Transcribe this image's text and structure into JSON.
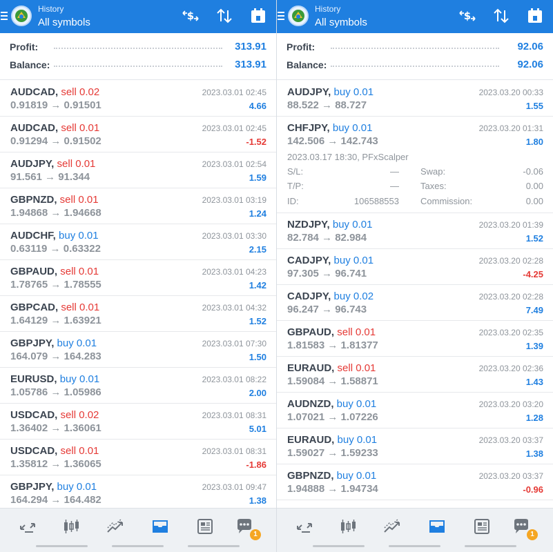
{
  "left": {
    "header": {
      "subtitle": "History",
      "title": "All symbols"
    },
    "summary": {
      "profit_label": "Profit:",
      "profit_value": "313.91",
      "balance_label": "Balance:",
      "balance_value": "313.91"
    },
    "trades": [
      {
        "symbol": "AUDCAD,",
        "side": "sell 0.02",
        "prices": "0.91819 → 0.91501",
        "time": "2023.03.01 02:45",
        "profit": "4.66"
      },
      {
        "symbol": "AUDCAD,",
        "side": "sell 0.01",
        "prices": "0.91294 → 0.91502",
        "time": "2023.03.01 02:45",
        "profit": "-1.52"
      },
      {
        "symbol": "AUDJPY,",
        "side": "sell 0.01",
        "prices": "91.561 → 91.344",
        "time": "2023.03.01 02:54",
        "profit": "1.59"
      },
      {
        "symbol": "GBPNZD,",
        "side": "sell 0.01",
        "prices": "1.94868 → 1.94668",
        "time": "2023.03.01 03:19",
        "profit": "1.24"
      },
      {
        "symbol": "AUDCHF,",
        "side": "buy 0.01",
        "prices": "0.63119 → 0.63322",
        "time": "2023.03.01 03:30",
        "profit": "2.15"
      },
      {
        "symbol": "GBPAUD,",
        "side": "sell 0.01",
        "prices": "1.78765 → 1.78555",
        "time": "2023.03.01 04:23",
        "profit": "1.42"
      },
      {
        "symbol": "GBPCAD,",
        "side": "sell 0.01",
        "prices": "1.64129 → 1.63921",
        "time": "2023.03.01 04:32",
        "profit": "1.52"
      },
      {
        "symbol": "GBPJPY,",
        "side": "buy 0.01",
        "prices": "164.079 → 164.283",
        "time": "2023.03.01 07:30",
        "profit": "1.50"
      },
      {
        "symbol": "EURUSD,",
        "side": "buy 0.01",
        "prices": "1.05786 → 1.05986",
        "time": "2023.03.01 08:22",
        "profit": "2.00"
      },
      {
        "symbol": "USDCAD,",
        "side": "sell 0.02",
        "prices": "1.36402 → 1.36061",
        "time": "2023.03.01 08:31",
        "profit": "5.01"
      },
      {
        "symbol": "USDCAD,",
        "side": "sell 0.01",
        "prices": "1.35812 → 1.36065",
        "time": "2023.03.01 08:31",
        "profit": "-1.86"
      },
      {
        "symbol": "GBPJPY,",
        "side": "buy 0.01",
        "prices": "164.294 → 164.482",
        "time": "2023.03.01 09:47",
        "profit": "1.38"
      }
    ]
  },
  "right": {
    "header": {
      "subtitle": "History",
      "title": "All symbols"
    },
    "summary": {
      "profit_label": "Profit:",
      "profit_value": "92.06",
      "balance_label": "Balance:",
      "balance_value": "92.06"
    },
    "trades": [
      {
        "symbol": "AUDJPY,",
        "side": "buy 0.01",
        "prices": "88.522 → 88.727",
        "time": "2023.03.20 00:33",
        "profit": "1.55"
      },
      {
        "symbol": "CHFJPY,",
        "side": "buy 0.01",
        "prices": "142.506 → 142.743",
        "time": "2023.03.20 01:31",
        "profit": "1.80",
        "details": {
          "open_info": "2023.03.17 18:30, PFxScalper",
          "sl_label": "S/L:",
          "sl_value": "—",
          "tp_label": "T/P:",
          "tp_value": "—",
          "id_label": "ID:",
          "id_value": "106588553",
          "swap_label": "Swap:",
          "swap_value": "-0.06",
          "taxes_label": "Taxes:",
          "taxes_value": "0.00",
          "commission_label": "Commission:",
          "commission_value": "0.00"
        }
      },
      {
        "symbol": "NZDJPY,",
        "side": "buy 0.01",
        "prices": "82.784 → 82.984",
        "time": "2023.03.20 01:39",
        "profit": "1.52"
      },
      {
        "symbol": "CADJPY,",
        "side": "buy 0.01",
        "prices": "97.305 → 96.741",
        "time": "2023.03.20 02:28",
        "profit": "-4.25"
      },
      {
        "symbol": "CADJPY,",
        "side": "buy 0.02",
        "prices": "96.247 → 96.743",
        "time": "2023.03.20 02:28",
        "profit": "7.49"
      },
      {
        "symbol": "GBPAUD,",
        "side": "sell 0.01",
        "prices": "1.81583 → 1.81377",
        "time": "2023.03.20 02:35",
        "profit": "1.39"
      },
      {
        "symbol": "EURAUD,",
        "side": "sell 0.01",
        "prices": "1.59084 → 1.58871",
        "time": "2023.03.20 02:36",
        "profit": "1.43"
      },
      {
        "symbol": "AUDNZD,",
        "side": "buy 0.01",
        "prices": "1.07021 → 1.07226",
        "time": "2023.03.20 03:20",
        "profit": "1.28"
      },
      {
        "symbol": "EURAUD,",
        "side": "buy 0.01",
        "prices": "1.59027 → 1.59233",
        "time": "2023.03.20 03:37",
        "profit": "1.38"
      },
      {
        "symbol": "GBPNZD,",
        "side": "buy 0.01",
        "prices": "1.94888 → 1.94734",
        "time": "2023.03.20 03:37",
        "profit": "-0.96"
      }
    ]
  },
  "bottom_nav": {
    "items": [
      "quotes-icon",
      "chart-icon",
      "trade-icon",
      "history-icon",
      "news-icon",
      "messages-icon"
    ],
    "messages_badge": "1"
  },
  "colors": {
    "brand": "#1f7fe0",
    "sell": "#e53935",
    "buy": "#1f7fe0",
    "muted": "#8e949b"
  }
}
